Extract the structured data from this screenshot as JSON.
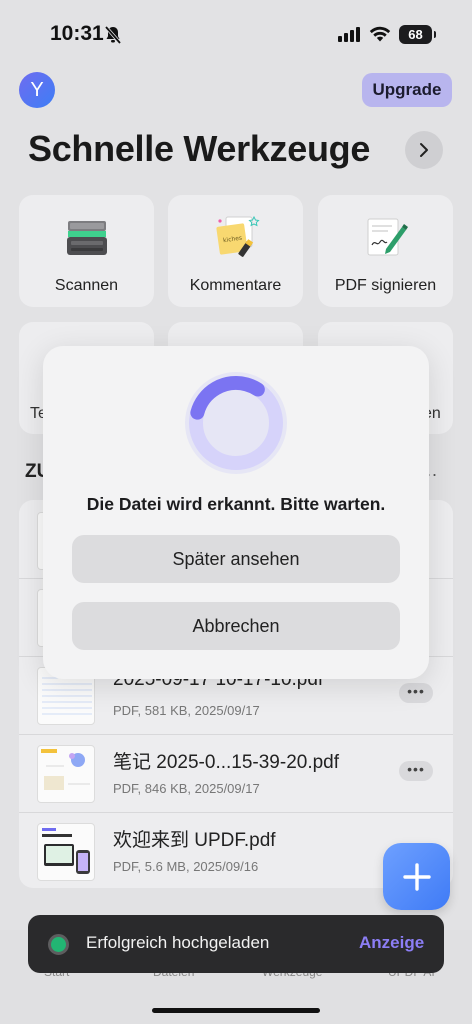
{
  "status": {
    "time": "10:31",
    "battery": "68"
  },
  "header": {
    "avatar_letter": "Y",
    "upgrade_label": "Upgrade",
    "title": "Schnelle Werkzeuge"
  },
  "tools": [
    {
      "label": "Scannen",
      "icon": "scanner-icon"
    },
    {
      "label": "Kommentare",
      "icon": "sticky-note-icon"
    },
    {
      "label": "PDF signieren",
      "icon": "signature-pen-icon"
    }
  ],
  "tools_row2_peek": {
    "left": "Te",
    "right": "en"
  },
  "section": {
    "title": "ZU",
    "more": "..."
  },
  "files": [
    {
      "name": "2025-09-17 10-17-10.pdf",
      "meta": "PDF, 581 KB, 2025/09/17"
    },
    {
      "name": " 笔记 2025-0...15-39-20.pdf",
      "meta": "PDF, 846 KB, 2025/09/17"
    },
    {
      "name": "欢迎来到 UPDF.pdf",
      "meta": "PDF, 5.6 MB, 2025/09/16"
    }
  ],
  "modal": {
    "message": "Die Datei wird erkannt. Bitte warten.",
    "later_label": "Später ansehen",
    "cancel_label": "Abbrechen",
    "progress": 0.3
  },
  "toast": {
    "message": "Erfolgreich hochgeladen",
    "action": "Anzeige"
  },
  "tabs": [
    "Start",
    "Dateien",
    "Werkzeuge",
    "UPDF AI"
  ],
  "colors": {
    "accent": "#6f6cf0",
    "fab": "#4f8cf8",
    "toast_action": "#8c7ef5",
    "success": "#22b573"
  }
}
